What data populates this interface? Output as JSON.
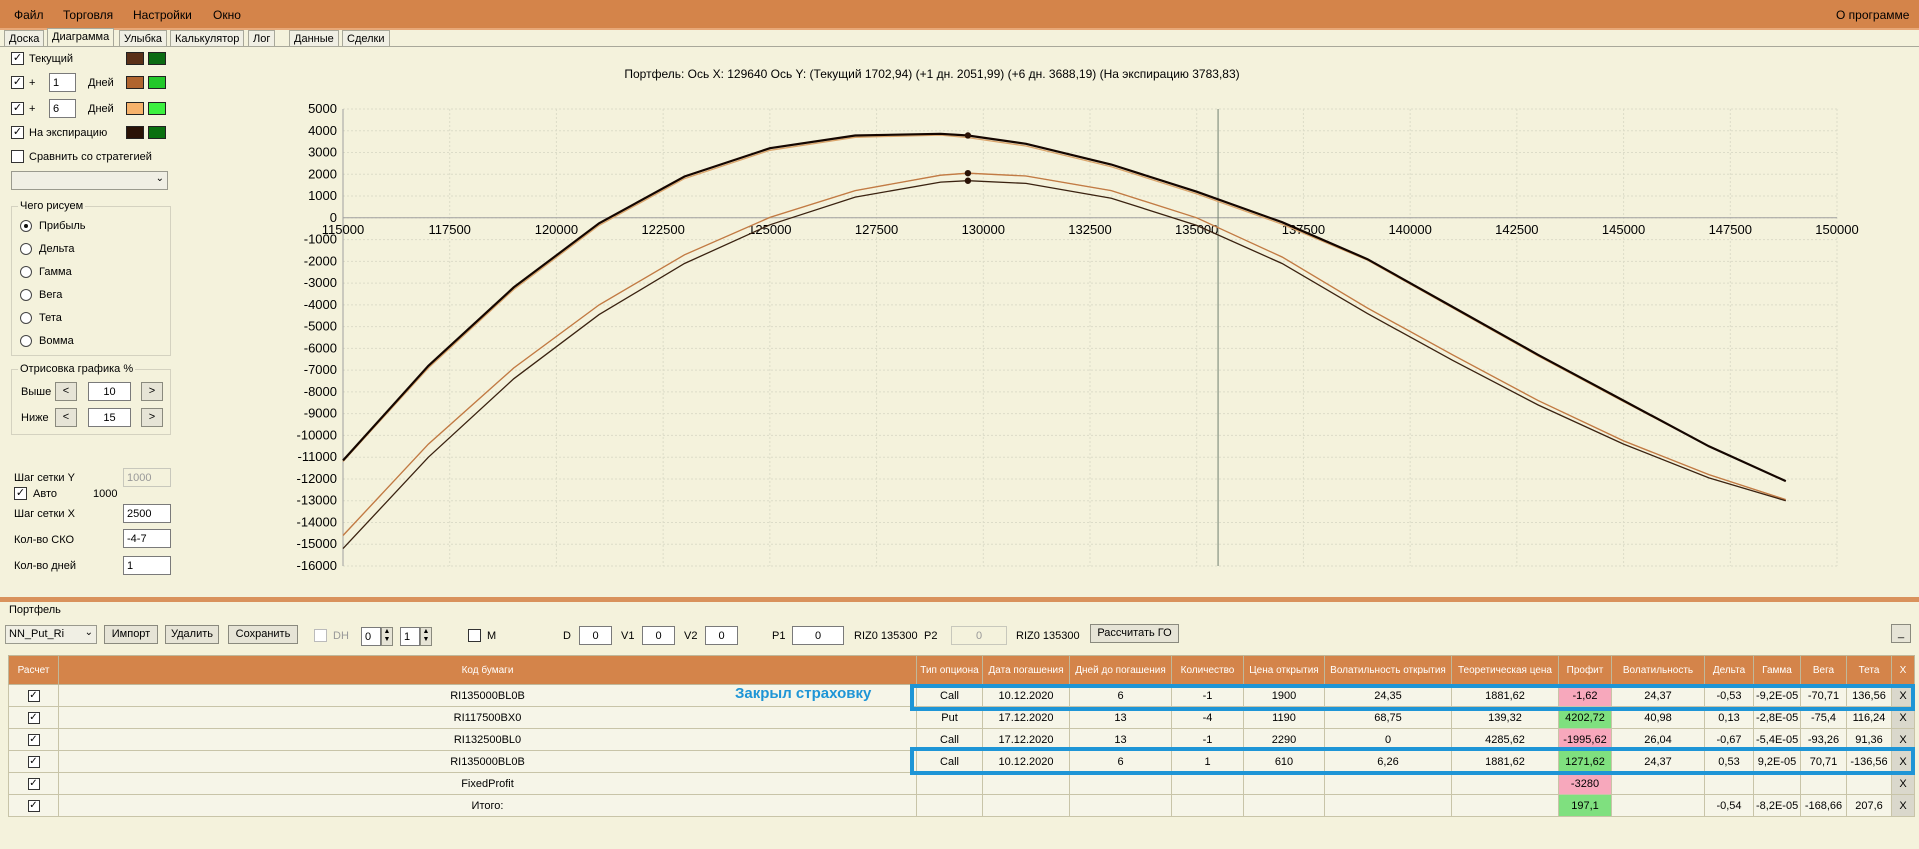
{
  "menu": {
    "items": [
      "Файл",
      "Торговля",
      "Настройки",
      "Окно"
    ],
    "about": "О программе"
  },
  "tabs": [
    "Доска",
    "Диаграмма",
    "Улыбка",
    "Калькулятор",
    "Лог",
    "Данные",
    "Сделки"
  ],
  "active_tab": "Диаграмма",
  "side": {
    "current_label": "Текущий",
    "plus_label": "+",
    "days1_value": "1",
    "days2_value": "6",
    "days_label": "Дней",
    "expiry_label": "На экспирацию",
    "compare_label": "Сравнить со стратегией",
    "compare_value": "",
    "draw_group_title": "Чего рисуем",
    "draw_options": [
      "Прибыль",
      "Дельта",
      "Гамма",
      "Вега",
      "Тета",
      "Вомма"
    ],
    "selected_option": "Прибыль",
    "render_group_title": "Отрисовка графика %",
    "above_label": "Выше",
    "above_value": "10",
    "below_label": "Ниже",
    "below_value": "15",
    "btn_less": "<",
    "btn_more": ">",
    "grid_y_label": "Шаг сетки Y",
    "grid_y_value": "1000",
    "auto_label": "Авто",
    "auto_value": "1000",
    "grid_x_label": "Шаг сетки X",
    "grid_x_value": "2500",
    "sko_label": "Кол-во СКО",
    "sko_value": "-4-7",
    "days_count_label": "Кол-во дней",
    "days_count_value": "1"
  },
  "colors": {
    "current_a": "#5a3018",
    "current_b": "#0b6b12",
    "plus1_a": "#b0642e",
    "plus1_b": "#22c82a",
    "plus6_a": "#f6b26b",
    "plus6_b": "#3cf040",
    "expiry_a": "#2a1206",
    "expiry_b": "#0a7010",
    "curve_current": "#3a2210",
    "curve_plus1": "#c07a45",
    "curve_plus6": "#f0c890",
    "curve_expiry": "#140600",
    "highlight": "#1e95d6",
    "header": "#d4844a",
    "profit_pos": "#7fe07f",
    "profit_neg": "#f7a8bc"
  },
  "chart_data": {
    "type": "line",
    "title": "Портфель: Ось X: 129640 Ось Y:  (Текущий 1702,94)  (+1 дн. 2051,99)  (+6 дн. 3688,19)  (На экспирацию 3783,83)",
    "xlim": [
      115000,
      150000
    ],
    "ylim": [
      -16000,
      5000
    ],
    "x_ticks": [
      115000,
      117500,
      120000,
      122500,
      125000,
      127500,
      130000,
      132500,
      135000,
      137500,
      140000,
      142500,
      145000,
      147500,
      150000
    ],
    "y_ticks": [
      5000,
      4000,
      3000,
      2000,
      1000,
      0,
      -1000,
      -2000,
      -3000,
      -4000,
      -5000,
      -6000,
      -7000,
      -8000,
      -9000,
      -10000,
      -11000,
      -12000,
      -13000,
      -14000,
      -15000,
      -16000
    ],
    "vline_x": 135500,
    "grid": true,
    "series": [
      {
        "color": "#f0c890",
        "x": [
          115000,
          117000,
          119000,
          121000,
          123000,
          125000,
          127000,
          129000,
          129640,
          131000,
          133000,
          135000,
          137000,
          139000,
          141000,
          143000,
          145000,
          147000,
          148800
        ],
        "y": [
          -14600,
          -10400,
          -6900,
          -4000,
          -1700,
          20,
          1250,
          1960,
          2052,
          1920,
          1250,
          0,
          -1800,
          -4150,
          -6300,
          -8400,
          -10250,
          -11800,
          -12950
        ]
      },
      {
        "color": "#c07a45",
        "x": [
          115000,
          117000,
          119000,
          121000,
          123000,
          125000,
          127000,
          129000,
          129640,
          131000,
          133000,
          135000,
          137000,
          139000,
          141000,
          143000,
          145000,
          147000,
          148800
        ],
        "y": [
          -14600,
          -10400,
          -6900,
          -4000,
          -1700,
          20,
          1250,
          1960,
          2052,
          1920,
          1250,
          0,
          -1800,
          -4150,
          -6300,
          -8400,
          -10250,
          -11800,
          -12950
        ]
      },
      {
        "color": "#3a2210",
        "x": [
          115000,
          117000,
          119000,
          121000,
          123000,
          125000,
          127000,
          129000,
          129640,
          131000,
          133000,
          135000,
          137000,
          139000,
          141000,
          143000,
          145000,
          147000,
          148800
        ],
        "y": [
          -15200,
          -11000,
          -7400,
          -4450,
          -2100,
          -320,
          950,
          1640,
          1703,
          1580,
          900,
          -350,
          -2100,
          -4400,
          -6550,
          -8600,
          -10400,
          -11950,
          -13000
        ]
      },
      {
        "color": "#dba56b",
        "x": [
          115000,
          117000,
          119000,
          121000,
          123000,
          125000,
          127000,
          129000,
          129640,
          131000,
          133000,
          135000,
          137000,
          139000,
          141000,
          143000,
          145000,
          147000,
          148800
        ],
        "y": [
          -11200,
          -6900,
          -3300,
          -350,
          1800,
          3100,
          3700,
          3800,
          3688,
          3300,
          2350,
          1100,
          -300,
          -1950,
          -4150,
          -6350,
          -8450,
          -10500,
          -12100
        ]
      },
      {
        "color": "#140600",
        "x": [
          115000,
          117000,
          119000,
          121000,
          123000,
          125000,
          127000,
          129000,
          129640,
          131000,
          133000,
          135000,
          137000,
          139000,
          141000,
          143000,
          145000,
          147000,
          148800
        ],
        "y": [
          -11150,
          -6800,
          -3200,
          -250,
          1900,
          3200,
          3780,
          3860,
          3784,
          3400,
          2450,
          1200,
          -200,
          -1900,
          -4100,
          -6300,
          -8400,
          -10500,
          -12100
        ]
      }
    ],
    "markers": [
      {
        "x": 129640,
        "y": 3784
      },
      {
        "x": 129640,
        "y": 2052
      },
      {
        "x": 129640,
        "y": 1703
      }
    ]
  },
  "portfolio": {
    "label": "Портфель",
    "combo_value": "NN_Put_Ri",
    "import_btn": "Импорт",
    "delete_btn": "Удалить",
    "save_btn": "Сохранить",
    "dh_label": "DH",
    "spin1_value": "0",
    "spin2_value": "1",
    "m_label": "M",
    "d_label": "D",
    "d_value": "0",
    "v1_label": "V1",
    "v1_value": "0",
    "v2_label": "V2",
    "v2_value": "0",
    "p1_label": "P1",
    "p1_value": "0",
    "p1_ticker": "RIZ0 135300",
    "p2_label": "P2",
    "p2_value": "0",
    "p2_ticker": "RIZ0 135300",
    "calc_go_btn": "Рассчитать ГО",
    "min_btn": "_"
  },
  "table": {
    "headers": [
      "Расчет",
      "Код бумаги",
      "Тип опциона",
      "Дата погашения",
      "Дней до погашения",
      "Количество",
      "Цена открытия",
      "Волатильность открытия",
      "Теоретическая цена",
      "Профит",
      "Волатильность",
      "Дельта",
      "Гамма",
      "Вега",
      "Тета",
      "X"
    ],
    "rows": [
      {
        "code": "RI135000BL0B",
        "type": "Call",
        "date": "10.12.2020",
        "days": "6",
        "qty": "-1",
        "open_price": "1900",
        "open_vol": "24,35",
        "theo": "1881,62",
        "profit": "-1,62",
        "vol": "24,37",
        "delta": "-0,53",
        "gamma": "-9,2E-05",
        "vega": "-70,71",
        "theta": "136,56",
        "x": "X",
        "profit_sign": "neg"
      },
      {
        "code": "RI117500BX0",
        "type": "Put",
        "date": "17.12.2020",
        "days": "13",
        "qty": "-4",
        "open_price": "1190",
        "open_vol": "68,75",
        "theo": "139,32",
        "profit": "4202,72",
        "vol": "40,98",
        "delta": "0,13",
        "gamma": "-2,8E-05",
        "vega": "-75,4",
        "theta": "116,24",
        "x": "X",
        "profit_sign": "pos"
      },
      {
        "code": "RI132500BL0",
        "type": "Call",
        "date": "17.12.2020",
        "days": "13",
        "qty": "-1",
        "open_price": "2290",
        "open_vol": "0",
        "theo": "4285,62",
        "profit": "-1995,62",
        "vol": "26,04",
        "delta": "-0,67",
        "gamma": "-5,4E-05",
        "vega": "-93,26",
        "theta": "91,36",
        "x": "X",
        "profit_sign": "neg"
      },
      {
        "code": "RI135000BL0B",
        "type": "Call",
        "date": "10.12.2020",
        "days": "6",
        "qty": "1",
        "open_price": "610",
        "open_vol": "6,26",
        "theo": "1881,62",
        "profit": "1271,62",
        "vol": "24,37",
        "delta": "0,53",
        "gamma": "9,2E-05",
        "vega": "70,71",
        "theta": "-136,56",
        "x": "X",
        "profit_sign": "pos"
      },
      {
        "code": "FixedProfit",
        "type": "",
        "date": "",
        "days": "",
        "qty": "",
        "open_price": "",
        "open_vol": "",
        "theo": "",
        "profit": "-3280",
        "vol": "",
        "delta": "",
        "gamma": "",
        "vega": "",
        "theta": "",
        "x": "X",
        "profit_sign": "neg"
      },
      {
        "code": "Итого:",
        "type": "",
        "date": "",
        "days": "",
        "qty": "",
        "open_price": "",
        "open_vol": "",
        "theo": "",
        "profit": "197,1",
        "vol": "",
        "delta": "-0,54",
        "gamma": "-8,2E-05",
        "vega": "-168,66",
        "theta": "207,6",
        "x": "X",
        "profit_sign": "pos"
      }
    ]
  },
  "annotation": "Закрыл страховку"
}
